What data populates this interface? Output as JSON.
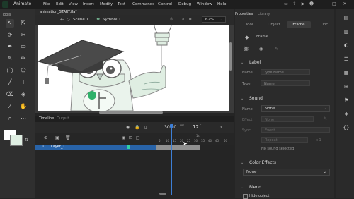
{
  "app": {
    "name": "Animate"
  },
  "menu": [
    "File",
    "Edit",
    "View",
    "Insert",
    "Modify",
    "Text",
    "Commands",
    "Control",
    "Debug",
    "Window",
    "Help"
  ],
  "document": {
    "tab_title": "animation_START.fla*",
    "scene": "Scene 1",
    "symbol": "Symbol 1",
    "zoom": "62%"
  },
  "tools": {
    "header": "Tools"
  },
  "timeline": {
    "tab_timeline": "Timeline",
    "tab_output": "Output",
    "fps": "30.00",
    "fps_unit": "FPS",
    "current_frame": "12",
    "layer_name": "Layer_1",
    "ruler": [
      "1s",
      "5",
      "10",
      "15",
      "20",
      "25",
      "30",
      "35",
      "40",
      "45",
      "50"
    ]
  },
  "properties": {
    "header": "Properties",
    "library_tab": "Library",
    "tabs": [
      "Tool",
      "Object",
      "Frame",
      "Doc"
    ],
    "active_tab": "Frame",
    "frame_title": "Frame",
    "label_section": "Label",
    "label_name_label": "Name",
    "label_name_placeholder": "Type Name",
    "label_type_label": "Type",
    "label_type_value": "Name",
    "sound_section": "Sound",
    "sound_name_label": "Name",
    "sound_name_value": "None",
    "sound_effect_label": "Effect",
    "sound_effect_value": "None",
    "sound_sync_label": "Sync",
    "sound_sync_value": "Event",
    "sound_repeat_value": "Repeat",
    "sound_count": "x 1",
    "sound_status": "No sound selected",
    "color_section": "Color Effects",
    "color_value": "None",
    "blend_section": "Blend",
    "hide_object": "Hide object"
  },
  "colors": {
    "accent": "#2863a8",
    "playhead": "#3d7fd6",
    "stroke_swatch": "#ffffff",
    "fill_swatch": "#dfeee2"
  }
}
